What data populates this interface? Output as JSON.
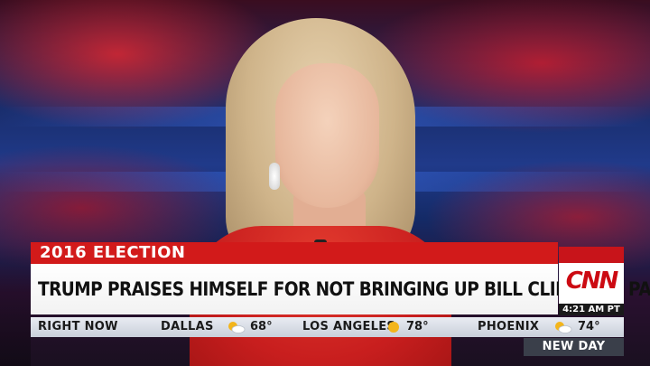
{
  "lower_third": {
    "topic_tag": "2016 ELECTION",
    "headline": "TRUMP PRAISES HIMSELF FOR NOT BRINGING UP BILL CLINTON'S PAST"
  },
  "network": {
    "logo_text": "CNN",
    "time": "4:21 AM PT",
    "show_name": "NEW DAY"
  },
  "ticker": {
    "label": "RIGHT NOW",
    "items": [
      {
        "city": "DALLAS",
        "temp": "68°",
        "icon": "partly-sunny-icon"
      },
      {
        "city": "LOS ANGELES",
        "temp": "78°",
        "icon": "sunny-icon"
      },
      {
        "city": "PHOENIX",
        "temp": "74°",
        "icon": "partly-sunny-icon"
      }
    ]
  },
  "colors": {
    "tag_red": "#d21a1a",
    "cnn_red": "#c8141a",
    "headline_bg": "#ffffff",
    "ticker_bg": "#dfe3ea"
  }
}
